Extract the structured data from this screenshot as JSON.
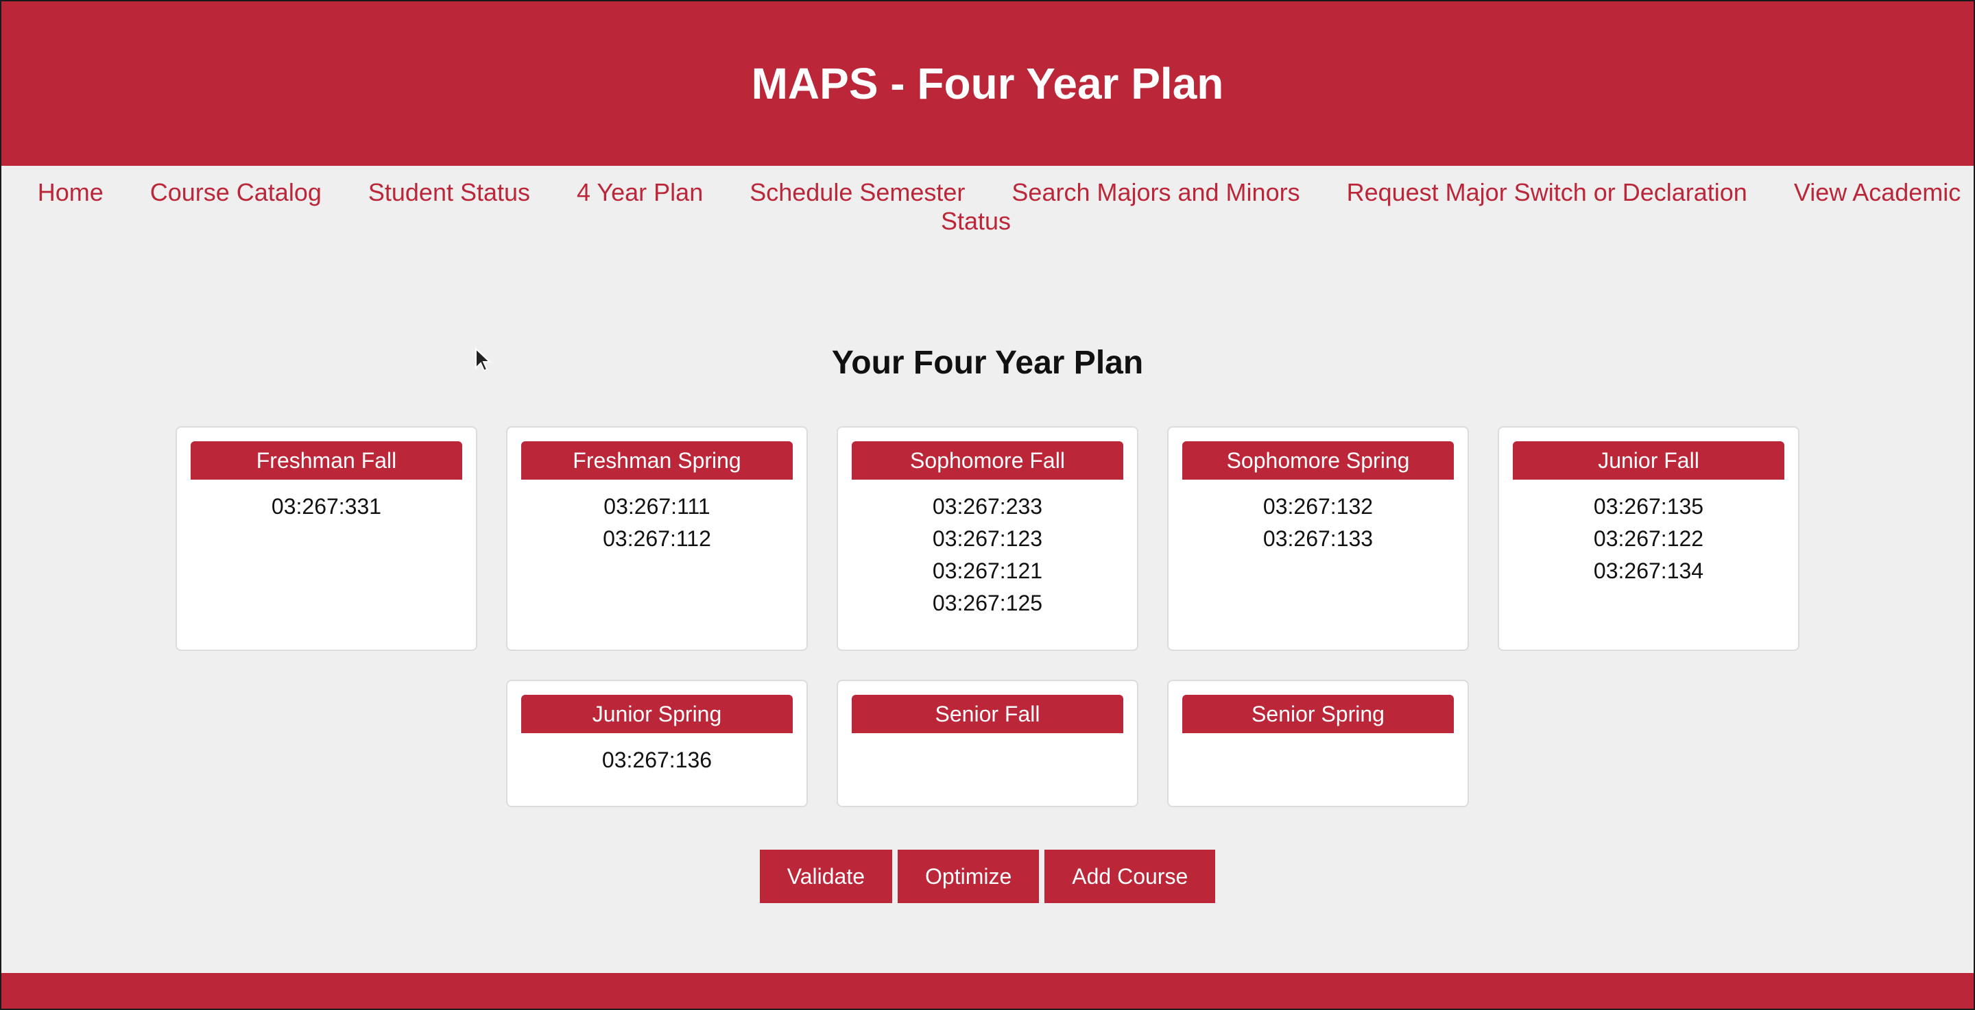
{
  "header": {
    "title": "MAPS - Four Year Plan"
  },
  "nav": {
    "items": [
      "Home",
      "Course Catalog",
      "Student Status",
      "4 Year Plan",
      "Schedule Semester",
      "Search Majors and Minors",
      "Request Major Switch or Declaration",
      "View Academic Status"
    ]
  },
  "plan": {
    "title": "Your Four Year Plan",
    "semesters": [
      {
        "name": "Freshman Fall",
        "courses": [
          "03:267:331"
        ]
      },
      {
        "name": "Freshman Spring",
        "courses": [
          "03:267:111",
          "03:267:112"
        ]
      },
      {
        "name": "Sophomore Fall",
        "courses": [
          "03:267:233",
          "03:267:123",
          "03:267:121",
          "03:267:125"
        ]
      },
      {
        "name": "Sophomore Spring",
        "courses": [
          "03:267:132",
          "03:267:133"
        ]
      },
      {
        "name": "Junior Fall",
        "courses": [
          "03:267:135",
          "03:267:122",
          "03:267:134"
        ]
      },
      {
        "name": "Junior Spring",
        "courses": [
          "03:267:136"
        ]
      },
      {
        "name": "Senior Fall",
        "courses": []
      },
      {
        "name": "Senior Spring",
        "courses": []
      }
    ]
  },
  "actions": {
    "validate_label": "Validate",
    "optimize_label": "Optimize",
    "add_course_label": "Add Course"
  },
  "colors": {
    "brand": "#bb2639",
    "background": "#efefef"
  }
}
